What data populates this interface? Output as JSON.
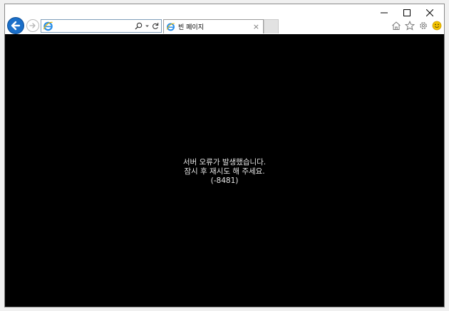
{
  "window": {
    "controls": [
      "minimize-icon",
      "maximize-icon",
      "close-icon"
    ]
  },
  "toolbar": {
    "back_icon": "arrow-left-icon",
    "forward_icon": "arrow-right-icon",
    "address": {
      "value": "",
      "icons": [
        "ie-logo-icon",
        "search-icon",
        "dropdown-icon",
        "refresh-icon"
      ]
    },
    "tab": {
      "title": "빈 페이지",
      "close": "×"
    },
    "right_icons": [
      "home-icon",
      "star-icon",
      "gear-icon",
      "smiley-icon"
    ]
  },
  "content": {
    "background": "#000000",
    "message_line1": "서버 오류가 발생했습니다.",
    "message_line2": "잠시 후 재시도 해 주세요.",
    "message_code": "(-8481)"
  },
  "colors": {
    "accent_blue": "#1a6fc9",
    "ie_logo": "#2a8ee8",
    "smiley": "#f2c200"
  }
}
